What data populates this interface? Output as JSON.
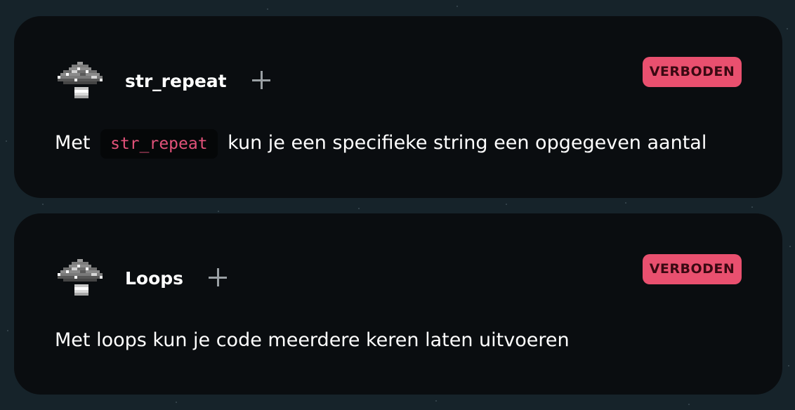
{
  "items": [
    {
      "title": "str_repeat",
      "badge": "VERBODEN",
      "icon": "pixel-mushroom-icon",
      "desc_before": "Met",
      "code": "str_repeat",
      "desc_after": "kun je een specifieke string een opgegeven aantal"
    },
    {
      "title": "Loops",
      "badge": "VERBODEN",
      "icon": "pixel-mushroom-icon",
      "desc": "Met loops kun je code meerdere keren laten uitvoeren"
    }
  ],
  "colors": {
    "background": "#16232a",
    "card": "#0a0d10",
    "badge": "#e9506f",
    "code": "#e2527a"
  }
}
